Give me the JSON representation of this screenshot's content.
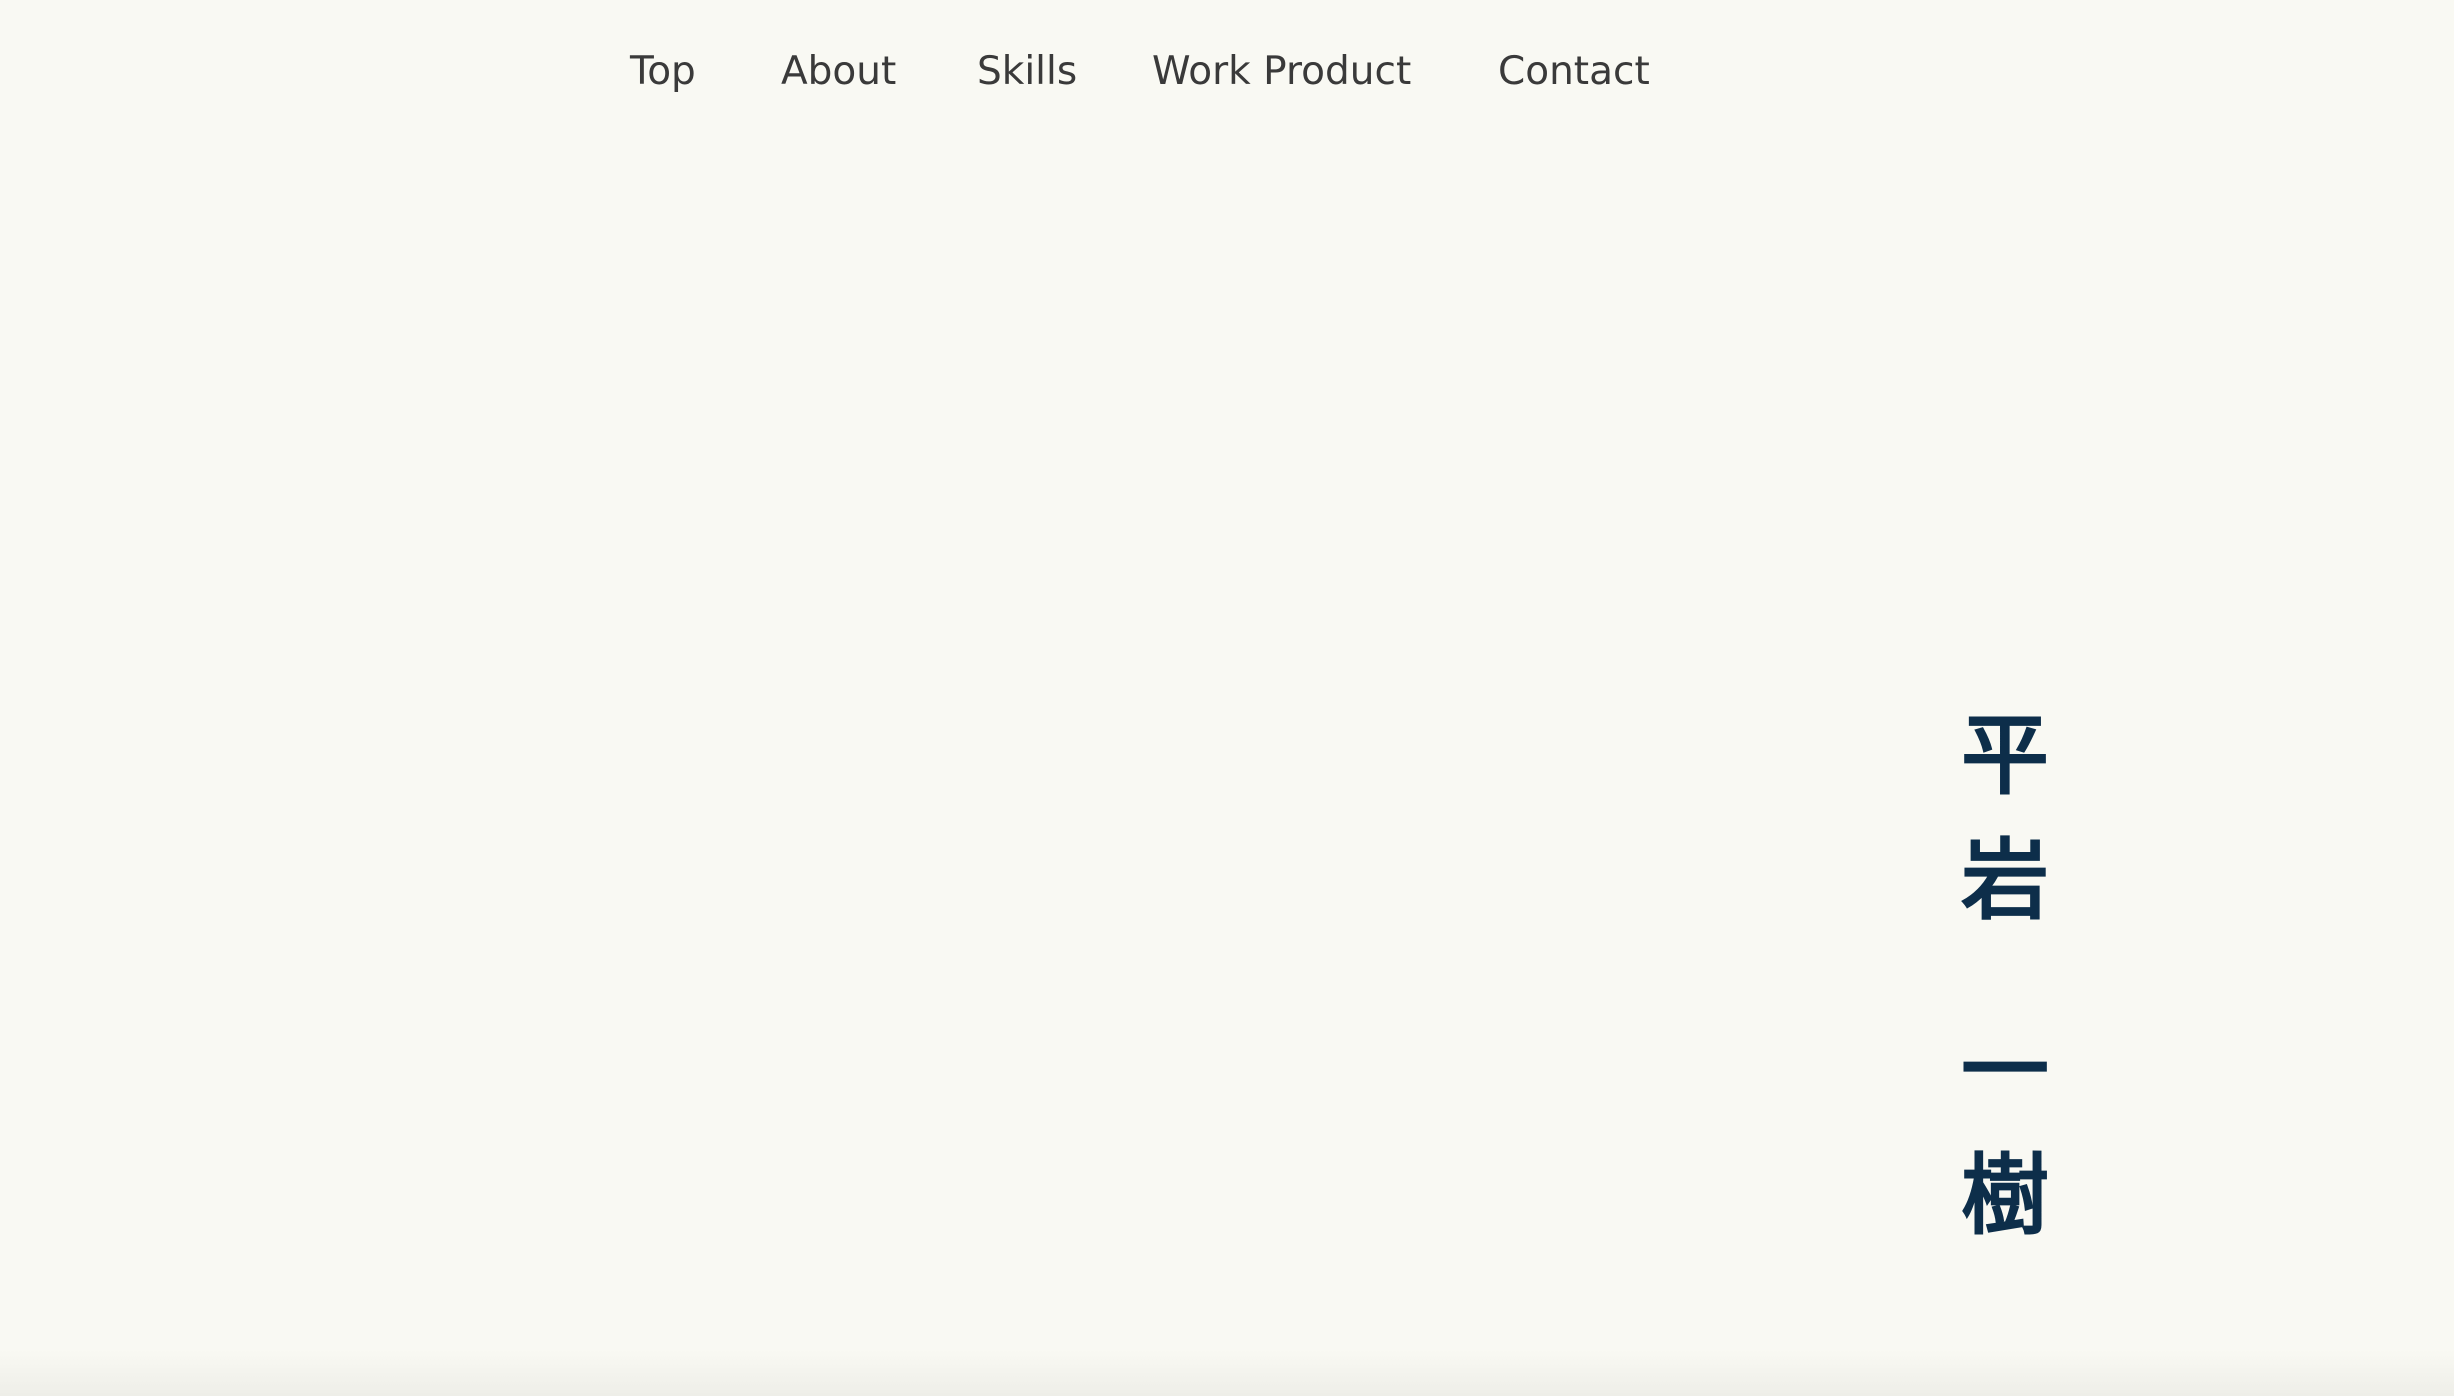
{
  "nav": {
    "items": [
      {
        "label": "Top"
      },
      {
        "label": "About"
      },
      {
        "label": "Skills"
      },
      {
        "label": "Work Product"
      },
      {
        "label": "Contact"
      }
    ]
  },
  "hero": {
    "name_chars": [
      "平",
      "岩",
      "一",
      "樹"
    ]
  },
  "colors": {
    "background": "#f9f9f3",
    "nav_text": "#3a3a3a",
    "name_ink": "#0d2e4a"
  }
}
